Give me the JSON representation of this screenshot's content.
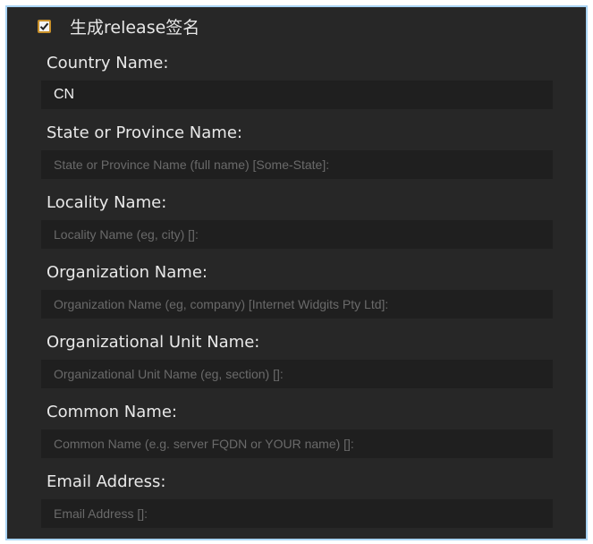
{
  "release_checkbox": {
    "checked": true,
    "label": "生成release签名"
  },
  "fields": [
    {
      "label": "Country Name:",
      "value": "CN",
      "placeholder": ""
    },
    {
      "label": "State or Province Name:",
      "value": "",
      "placeholder": "State or Province Name (full name) [Some-State]:"
    },
    {
      "label": "Locality Name:",
      "value": "",
      "placeholder": "Locality Name (eg, city) []:"
    },
    {
      "label": "Organization Name:",
      "value": "",
      "placeholder": "Organization Name (eg, company) [Internet Widgits Pty Ltd]:"
    },
    {
      "label": "Organizational Unit Name:",
      "value": "",
      "placeholder": "Organizational Unit Name (eg, section) []:"
    },
    {
      "label": "Common Name:",
      "value": "",
      "placeholder": "Common Name (e.g. server FQDN or YOUR name) []:"
    },
    {
      "label": "Email Address:",
      "value": "",
      "placeholder": "Email Address []:"
    }
  ],
  "colors": {
    "background": "#272727",
    "input_background": "#1f1f1f",
    "checkbox_border": "#c8902a",
    "frame_border": "#a9d4f5"
  }
}
